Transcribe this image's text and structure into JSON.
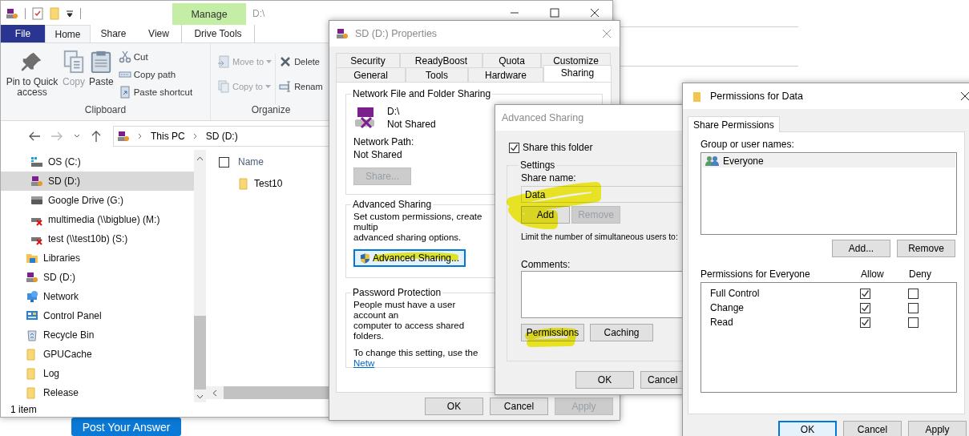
{
  "page_behind": {
    "button": "Post Your Answer"
  },
  "explorer": {
    "title": "D:\\",
    "context_group": "Manage",
    "tabs": [
      {
        "label": "File",
        "kind": "file",
        "selected": false
      },
      {
        "label": "Home",
        "kind": "normal",
        "selected": true
      },
      {
        "label": "Share",
        "kind": "normal",
        "selected": false
      },
      {
        "label": "View",
        "kind": "normal",
        "selected": false
      },
      {
        "label": "Drive Tools",
        "kind": "contextual",
        "selected": false
      }
    ],
    "ribbon_groups": [
      {
        "label": "Clipboard",
        "large": [
          {
            "label": "Pin to Quick access",
            "kind": "pin",
            "disabled": false
          },
          {
            "label": "Copy",
            "kind": "copy",
            "disabled": true
          },
          {
            "label": "Paste",
            "kind": "paste",
            "disabled": false
          }
        ],
        "small_columns": [
          [
            {
              "label": "Cut",
              "kind": "cut",
              "dropdown": false,
              "disabled": false
            },
            {
              "label": "Copy path",
              "kind": "copy-path",
              "dropdown": false,
              "disabled": false
            },
            {
              "label": "Paste shortcut",
              "kind": "paste-shortcut",
              "dropdown": false,
              "disabled": false
            }
          ]
        ]
      },
      {
        "label": "Organize",
        "small_columns": [
          [
            {
              "label": "Move to",
              "kind": "move",
              "dropdown": true,
              "disabled": true
            },
            {
              "label": "Copy to",
              "kind": "copy-to",
              "dropdown": true,
              "disabled": true
            }
          ],
          [
            {
              "label": "Delete",
              "kind": "delete",
              "dropdown": false,
              "disabled": false
            },
            {
              "label": "Renam",
              "kind": "rename",
              "dropdown": false,
              "disabled": false
            }
          ]
        ]
      }
    ],
    "address": [
      "This PC",
      "SD (D:)"
    ],
    "nav_drives": [
      {
        "label": "OS (C:)",
        "kind": "os-drive",
        "selected": false
      },
      {
        "label": "SD (D:)",
        "kind": "sd",
        "selected": true
      },
      {
        "label": "Google Drive (G:)",
        "kind": "drive",
        "selected": false
      },
      {
        "label": "multimedia (\\\\bigblue) (M:)",
        "kind": "net-drive-off",
        "selected": false
      },
      {
        "label": "test (\\\\test10b) (S:)",
        "kind": "net-drive-off",
        "selected": false
      }
    ],
    "nav_items": [
      {
        "label": "Libraries",
        "kind": "library",
        "selected": false
      },
      {
        "label": "SD (D:)",
        "kind": "sd",
        "selected": false
      },
      {
        "label": "Network",
        "kind": "network",
        "selected": false
      },
      {
        "label": "Control Panel",
        "kind": "control-panel",
        "selected": false
      },
      {
        "label": "Recycle Bin",
        "kind": "recycle-bin",
        "selected": false
      },
      {
        "label": "GPUCache",
        "kind": "folder",
        "selected": false
      },
      {
        "label": "Log",
        "kind": "folder",
        "selected": false
      },
      {
        "label": "Release",
        "kind": "folder",
        "selected": false
      }
    ],
    "file_list": {
      "column": "Name",
      "select_all_checked": false,
      "rows": [
        {
          "name": "Test10"
        }
      ]
    },
    "status": "1 item"
  },
  "properties": {
    "title": "SD (D:) Properties",
    "tab_rows": [
      [
        {
          "label": "Security",
          "selected": false
        },
        {
          "label": "ReadyBoost",
          "selected": false
        },
        {
          "label": "Quota",
          "selected": false
        },
        {
          "label": "Customize",
          "selected": false
        }
      ],
      [
        {
          "label": "General",
          "selected": false
        },
        {
          "label": "Tools",
          "selected": false
        },
        {
          "label": "Hardware",
          "selected": false
        },
        {
          "label": "Sharing",
          "selected": true
        }
      ]
    ],
    "network_sharing": {
      "legend": "Network File and Folder Sharing",
      "path": "D:\\",
      "state": "Not Shared",
      "network_path_label": "Network Path:",
      "network_path": "Not Shared",
      "button": {
        "label": "Share...",
        "disabled": true
      }
    },
    "advanced_sharing": {
      "legend": "Advanced Sharing",
      "lines": [
        "Set custom permissions, create multip",
        "advanced sharing options."
      ],
      "button": {
        "label": "Advanced Sharing...",
        "focused": true
      }
    },
    "password_protection": {
      "legend": "Password Protection",
      "lines": [
        "People must have a user account an",
        "computer to access shared folders."
      ],
      "note": "To change this setting, use the",
      "link": "Netw"
    },
    "buttons": [
      {
        "label": "OK",
        "disabled": false
      },
      {
        "label": "Cancel",
        "disabled": false
      },
      {
        "label": "Apply",
        "disabled": true
      }
    ]
  },
  "advanced_dialog": {
    "title": "Advanced Sharing",
    "share_checkbox": {
      "label": "Share this folder",
      "checked": true
    },
    "settings_legend": "Settings",
    "share_name_label": "Share name:",
    "share_name": "Data",
    "name_buttons": [
      {
        "label": "Add",
        "disabled": false
      },
      {
        "label": "Remove",
        "disabled": true
      }
    ],
    "limit_label": "Limit the number of simultaneous users to:",
    "comments_label": "Comments:",
    "lower_buttons": [
      {
        "label": "Permissions",
        "disabled": false
      },
      {
        "label": "Caching",
        "disabled": false
      }
    ],
    "buttons": [
      {
        "label": "OK",
        "disabled": false
      },
      {
        "label": "Cancel",
        "disabled": false
      }
    ]
  },
  "permissions_dialog": {
    "title": "Permissions for Data",
    "tab": {
      "label": "Share Permissions",
      "selected": true
    },
    "group_label": "Group or user names:",
    "users": [
      {
        "name": "Everyone",
        "selected": true
      }
    ],
    "user_buttons": [
      {
        "label": "Add...",
        "disabled": false
      },
      {
        "label": "Remove",
        "disabled": false
      }
    ],
    "permissions_label": "Permissions for Everyone",
    "columns": [
      "Allow",
      "Deny"
    ],
    "rows": [
      {
        "name": "Full Control",
        "allow": true,
        "deny": false
      },
      {
        "name": "Change",
        "allow": true,
        "deny": false
      },
      {
        "name": "Read",
        "allow": true,
        "deny": false
      }
    ],
    "buttons": [
      {
        "label": "OK",
        "default": true
      },
      {
        "label": "Cancel",
        "default": false
      },
      {
        "label": "Apply",
        "default": false
      }
    ]
  }
}
